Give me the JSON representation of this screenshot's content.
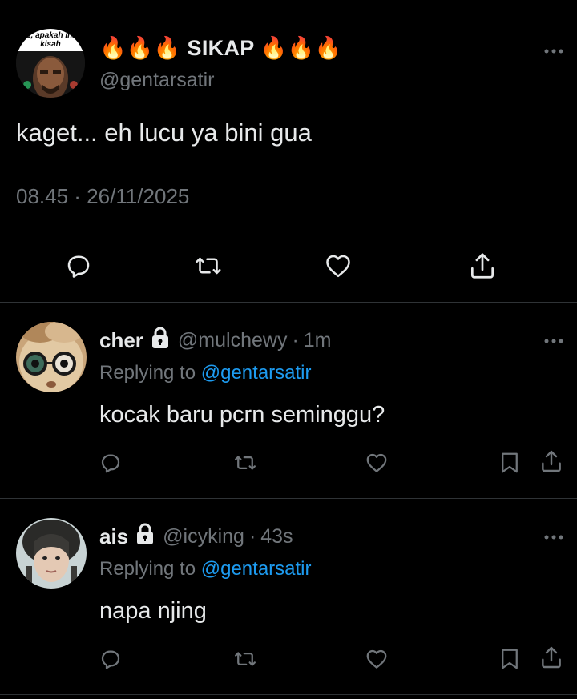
{
  "main_tweet": {
    "display_name": "🔥🔥🔥 SIKAP 🔥🔥🔥",
    "handle": "@gentarsatir",
    "avatar_caption": "s, apakah ini kisah",
    "text": "kaget... eh lucu ya bini gua",
    "timestamp": "08.45 · 26/11/2025",
    "more_icon": "more-horizontal-icon",
    "actions": [
      "reply-icon",
      "retweet-icon",
      "like-icon",
      "share-icon"
    ]
  },
  "replies": [
    {
      "display_name": "cher",
      "handle": "@mulchewy",
      "separator": "·",
      "age": "1m",
      "replying_label": "Replying to",
      "replying_to": "@gentarsatir",
      "text": "kocak baru pcrn seminggu?"
    },
    {
      "display_name": "ais",
      "handle": "@icyking",
      "separator": "·",
      "age": "43s",
      "replying_label": "Replying to",
      "replying_to": "@gentarsatir",
      "text": "napa njing"
    }
  ],
  "colors": {
    "background": "#000000",
    "text_primary": "#e7e9ea",
    "text_secondary": "#71767b",
    "link": "#1d9bf0",
    "divider": "#2f3336"
  }
}
